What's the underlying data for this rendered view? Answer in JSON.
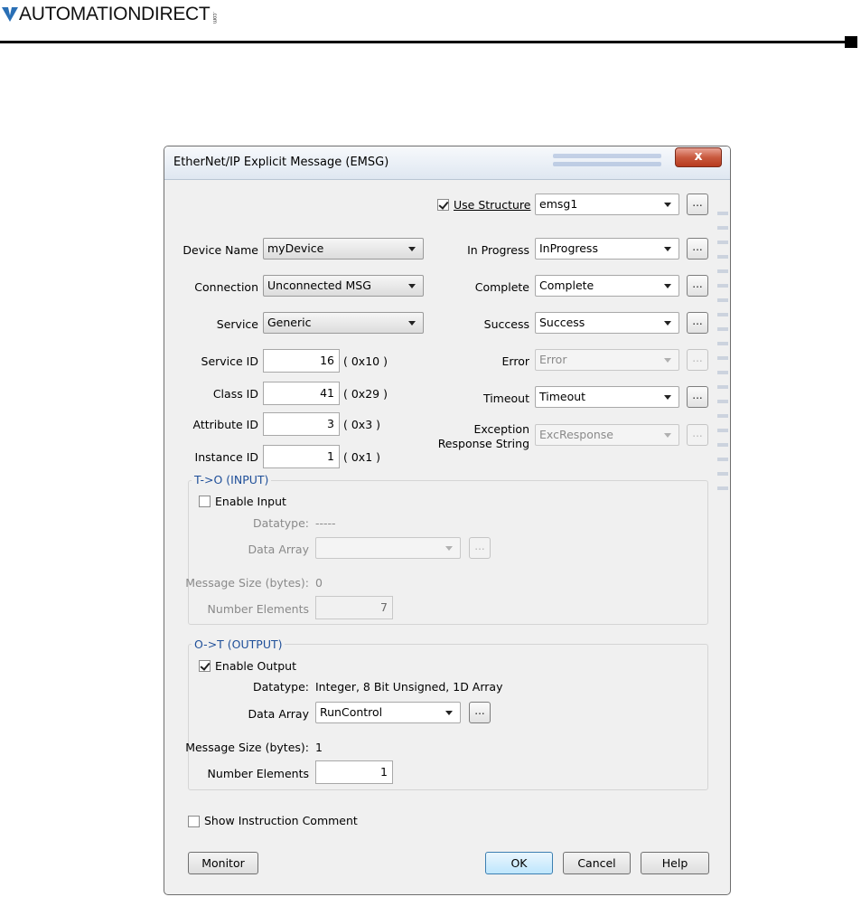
{
  "header": {
    "brand": "AUTOMATIONDIRECT",
    "brand_suffix": ".com"
  },
  "dialog": {
    "title": "EtherNet/IP Explicit Message (EMSG)",
    "close_glyph": "x",
    "use_structure": {
      "label": "Use Structure",
      "checked": true,
      "value": "emsg1"
    },
    "left": {
      "device_name": {
        "label": "Device Name",
        "value": "myDevice"
      },
      "connection": {
        "label": "Connection",
        "value": "Unconnected MSG"
      },
      "service": {
        "label": "Service",
        "value": "Generic"
      },
      "service_id": {
        "label": "Service ID",
        "value": "16",
        "hex": "( 0x10 )"
      },
      "class_id": {
        "label": "Class ID",
        "value": "41",
        "hex": "( 0x29 )"
      },
      "attribute_id": {
        "label": "Attribute ID",
        "value": "3",
        "hex": "( 0x3 )"
      },
      "instance_id": {
        "label": "Instance ID",
        "value": "1",
        "hex": "( 0x1 )"
      }
    },
    "right": {
      "in_progress": {
        "label": "In Progress",
        "value": "InProgress"
      },
      "complete": {
        "label": "Complete",
        "value": "Complete"
      },
      "success": {
        "label": "Success",
        "value": "Success"
      },
      "error": {
        "label": "Error",
        "value": "Error"
      },
      "timeout": {
        "label": "Timeout",
        "value": "Timeout"
      },
      "exception": {
        "label_line1": "Exception",
        "label_line2": "Response String",
        "value": "ExcResponse"
      }
    },
    "ellipsis": "...",
    "input_group": {
      "title": "T->O (INPUT)",
      "enable_label": "Enable Input",
      "enabled": false,
      "datatype_label": "Datatype:",
      "datatype_value": "-----",
      "data_array_label": "Data Array",
      "data_array_value": "",
      "msg_size_label": "Message Size (bytes):",
      "msg_size_value": "0",
      "num_elements_label": "Number Elements",
      "num_elements_value": "7"
    },
    "output_group": {
      "title": "O->T (OUTPUT)",
      "enable_label": "Enable Output",
      "enabled": true,
      "datatype_label": "Datatype:",
      "datatype_value": "Integer, 8 Bit Unsigned, 1D Array",
      "data_array_label": "Data Array",
      "data_array_value": "RunControl",
      "msg_size_label": "Message Size (bytes):",
      "msg_size_value": "1",
      "num_elements_label": "Number Elements",
      "num_elements_value": "1"
    },
    "show_comment": {
      "label": "Show Instruction Comment",
      "checked": false
    },
    "buttons": {
      "monitor": "Monitor",
      "ok": "OK",
      "cancel": "Cancel",
      "help": "Help"
    }
  },
  "colors": {
    "group_title": "#1f4f99",
    "close_button": "#c95a3f"
  }
}
